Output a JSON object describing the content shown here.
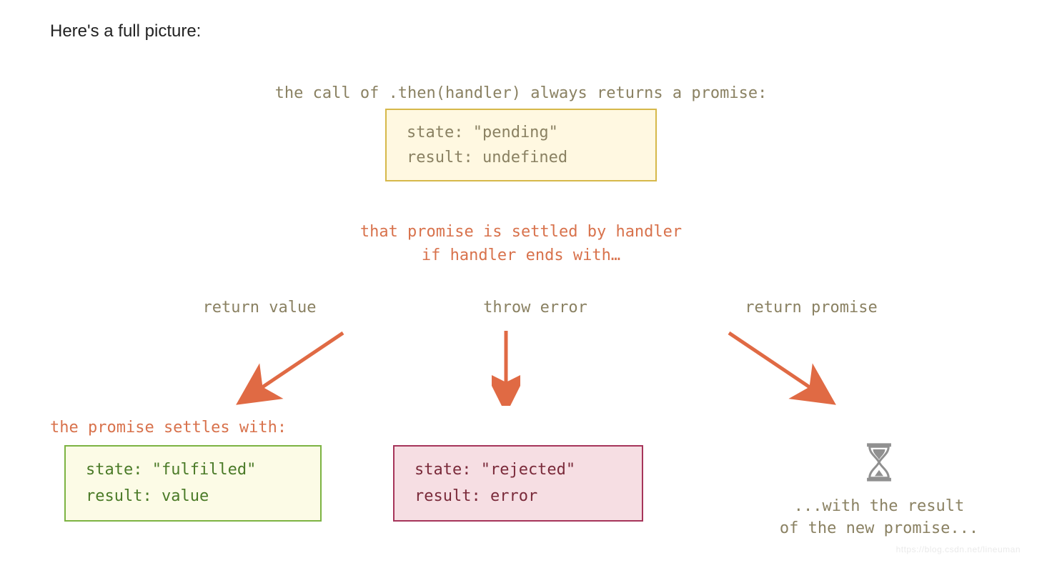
{
  "heading": "Here's a full picture:",
  "top_caption": "the call of .then(handler) always returns a promise:",
  "pending": {
    "state_line": "state: \"pending\"",
    "result_line": "result: undefined"
  },
  "settled": {
    "line1": "that promise is settled by handler",
    "line2": "if handler ends with…"
  },
  "branches": {
    "return_value": "return value",
    "throw_error": "throw error",
    "return_promise": "return promise"
  },
  "settles_with": "the promise settles with:",
  "fulfilled": {
    "state_line": "state:  \"fulfilled\"",
    "result_line": "result: value"
  },
  "rejected": {
    "state_line": "state:  \"rejected\"",
    "result_line": "result: error"
  },
  "new_promise": {
    "line1": "...with the result",
    "line2": "of the new promise..."
  },
  "colors": {
    "olive": "#8a8162",
    "orange": "#d8724c",
    "green_border": "#7cb342",
    "green_bg": "#fcfbe6",
    "red_border": "#a6355a",
    "red_bg": "#f6dee3",
    "pending_border": "#d6b84a",
    "pending_bg": "#fff8e1",
    "arrow": "#e06a44",
    "gray": "#909090"
  },
  "watermark": "https://blog.csdn.net/lineuman"
}
